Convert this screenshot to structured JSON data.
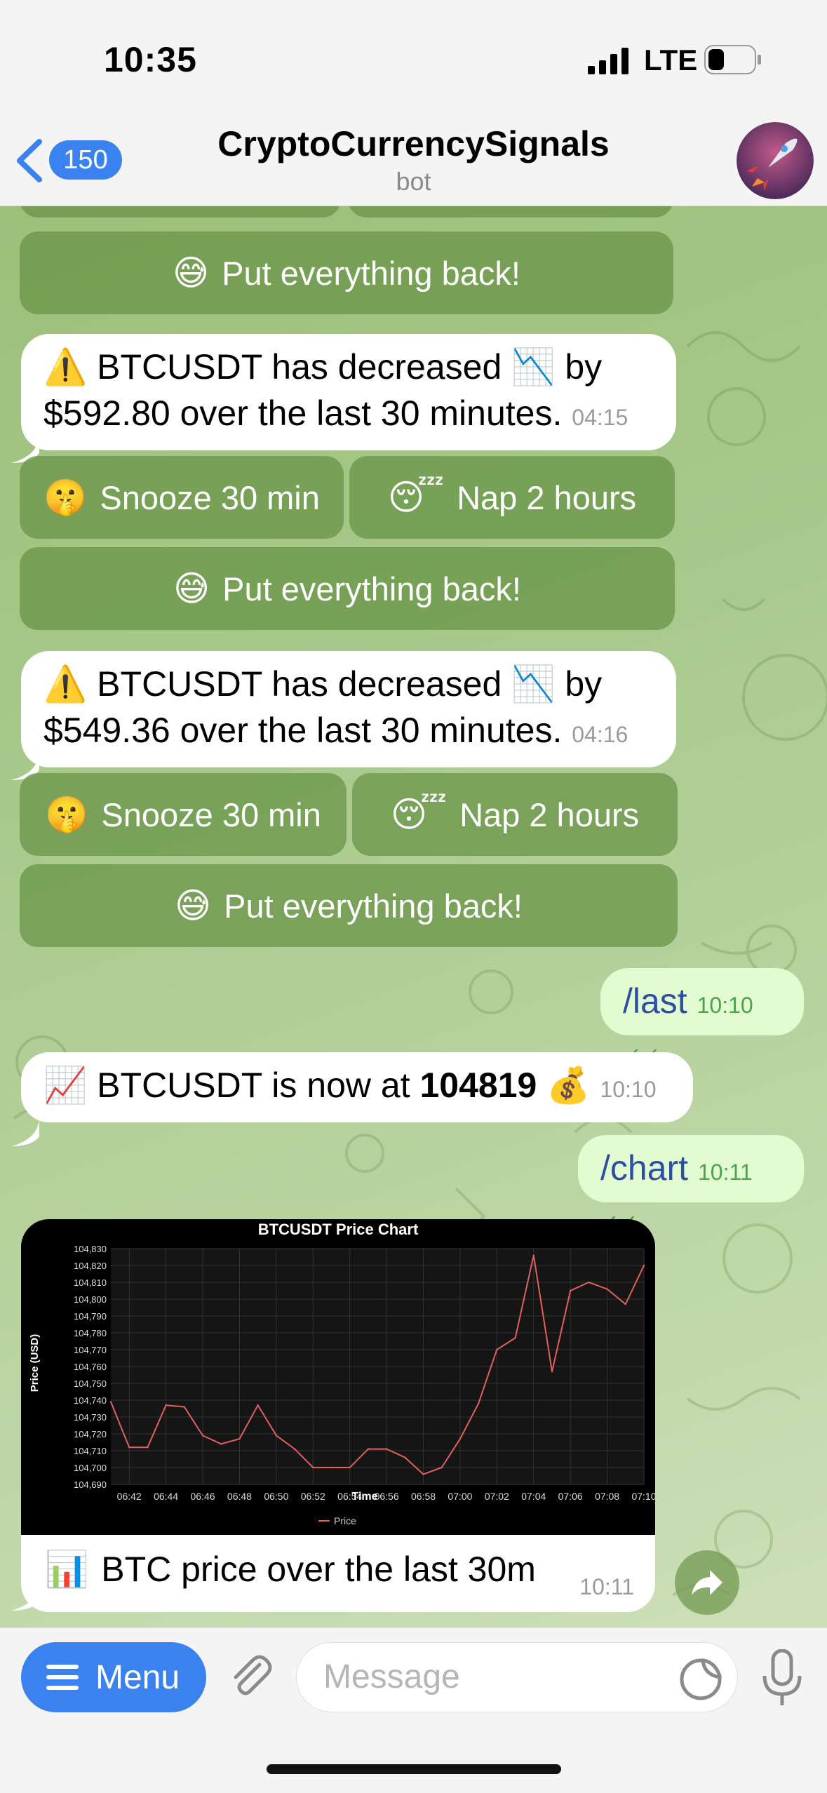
{
  "status": {
    "time": "10:35",
    "network": "LTE"
  },
  "header": {
    "back_count": "150",
    "title": "CryptoCurrencySignals",
    "subtitle": "bot"
  },
  "messages": {
    "kb_top": {
      "put_back": "Put everything back!"
    },
    "alert1": {
      "line1_pre": "BTCUSDT has decreased",
      "line1_post": "by",
      "line2": "$592.80 over the last 30 minutes.",
      "time": "04:15"
    },
    "kb1": {
      "snooze": "Snooze 30 min",
      "nap": "Nap 2 hours",
      "put_back": "Put everything back!"
    },
    "alert2": {
      "line1_pre": "BTCUSDT has decreased",
      "line1_post": "by",
      "line2": "$549.36 over the last 30 minutes.",
      "time": "04:16"
    },
    "kb2": {
      "snooze": "Snooze 30 min",
      "nap": "Nap 2 hours",
      "put_back": "Put everything back!"
    },
    "cmd_last": {
      "text": "/last",
      "time": "10:10"
    },
    "price": {
      "pre": "BTCUSDT is now at",
      "value": "104819",
      "time": "10:10"
    },
    "cmd_chart": {
      "text": "/chart",
      "time": "10:11"
    },
    "chart_msg": {
      "caption": "BTC price over the last 30m",
      "time": "10:11"
    }
  },
  "input": {
    "menu_label": "Menu",
    "placeholder": "Message"
  },
  "colors": {
    "accent": "#3a82f0",
    "line": "#e06060",
    "outgoing_bubble": "#e2fbd0"
  },
  "chart_data": {
    "type": "line",
    "title": "BTCUSDT Price Chart",
    "xlabel": "Time",
    "ylabel": "Price (USD)",
    "ylim": [
      104690,
      104830
    ],
    "yticks": [
      104830,
      104820,
      104810,
      104800,
      104790,
      104780,
      104770,
      104760,
      104750,
      104740,
      104730,
      104720,
      104710,
      104700,
      104690
    ],
    "xticks": [
      "06:42",
      "06:44",
      "06:46",
      "06:48",
      "06:50",
      "06:52",
      "06:54",
      "06:56",
      "06:58",
      "07:00",
      "07:02",
      "07:04",
      "07:06",
      "07:08",
      "07:10"
    ],
    "legend": "Price",
    "grid": true,
    "series": [
      {
        "name": "Price",
        "x": [
          "06:41",
          "06:42",
          "06:43",
          "06:44",
          "06:45",
          "06:46",
          "06:47",
          "06:48",
          "06:49",
          "06:50",
          "06:51",
          "06:52",
          "06:53",
          "06:54",
          "06:55",
          "06:56",
          "06:57",
          "06:58",
          "06:59",
          "07:00",
          "07:01",
          "07:02",
          "07:03",
          "07:04",
          "07:05",
          "07:06",
          "07:07",
          "07:08",
          "07:09",
          "07:10"
        ],
        "values": [
          104739,
          104712,
          104712,
          104737,
          104736,
          104719,
          104714,
          104717,
          104737,
          104719,
          104711,
          104700,
          104700,
          104700,
          104711,
          104711,
          104706,
          104696,
          104700,
          104717,
          104738,
          104770,
          104777,
          104826,
          104757,
          104805,
          104810,
          104806,
          104797,
          104820
        ]
      }
    ]
  }
}
